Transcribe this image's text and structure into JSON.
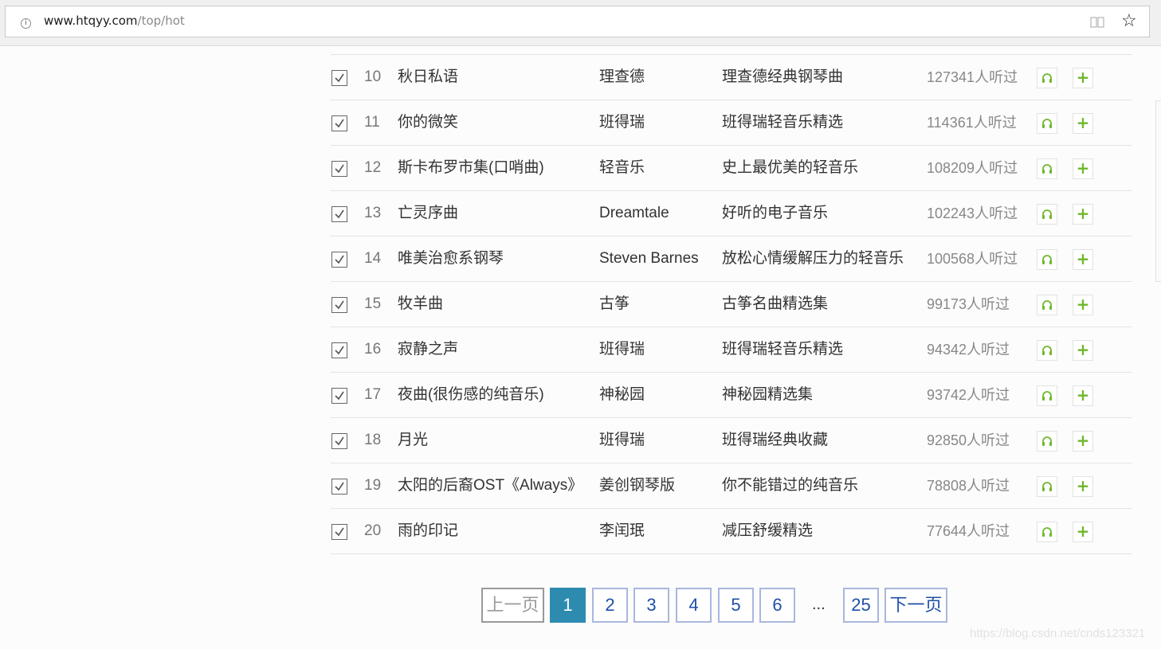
{
  "browser": {
    "url_host": "www.htqyy.com",
    "url_path": "/top/hot"
  },
  "rows": [
    {
      "num": "10",
      "title": "秋日私语",
      "artist": "理查德",
      "album": "理查德经典钢琴曲",
      "plays": "127341人听过"
    },
    {
      "num": "11",
      "title": "你的微笑",
      "artist": "班得瑞",
      "album": "班得瑞轻音乐精选",
      "plays": "114361人听过"
    },
    {
      "num": "12",
      "title": "斯卡布罗市集(口哨曲)",
      "artist": "轻音乐",
      "album": "史上最优美的轻音乐",
      "plays": "108209人听过"
    },
    {
      "num": "13",
      "title": "亡灵序曲",
      "artist": "Dreamtale",
      "album": "好听的电子音乐",
      "plays": "102243人听过"
    },
    {
      "num": "14",
      "title": "唯美治愈系钢琴",
      "artist": "Steven Barnes",
      "album": "放松心情缓解压力的轻音乐",
      "plays": "100568人听过"
    },
    {
      "num": "15",
      "title": "牧羊曲",
      "artist": "古筝",
      "album": "古筝名曲精选集",
      "plays": "99173人听过"
    },
    {
      "num": "16",
      "title": "寂静之声",
      "artist": "班得瑞",
      "album": "班得瑞轻音乐精选",
      "plays": "94342人听过"
    },
    {
      "num": "17",
      "title": "夜曲(很伤感的纯音乐)",
      "artist": "神秘园",
      "album": "神秘园精选集",
      "plays": "93742人听过"
    },
    {
      "num": "18",
      "title": "月光",
      "artist": "班得瑞",
      "album": "班得瑞经典收藏",
      "plays": "92850人听过"
    },
    {
      "num": "19",
      "title": "太阳的后裔OST《Always》",
      "artist": "姜创钢琴版",
      "album": "你不能错过的纯音乐",
      "plays": "78808人听过"
    },
    {
      "num": "20",
      "title": "雨的印记",
      "artist": "李闰珉",
      "album": "减压舒缓精选",
      "plays": "77644人听过"
    }
  ],
  "pagination": {
    "prev": "上一页",
    "pages": [
      "1",
      "2",
      "3",
      "4",
      "5",
      "6"
    ],
    "ellipsis": "...",
    "last": "25",
    "next": "下一页",
    "current": "1"
  },
  "watermark": "https://blog.csdn.net/cnds123321",
  "colors": {
    "accent": "#2e8bb0",
    "icon_green": "#6fb72c"
  }
}
